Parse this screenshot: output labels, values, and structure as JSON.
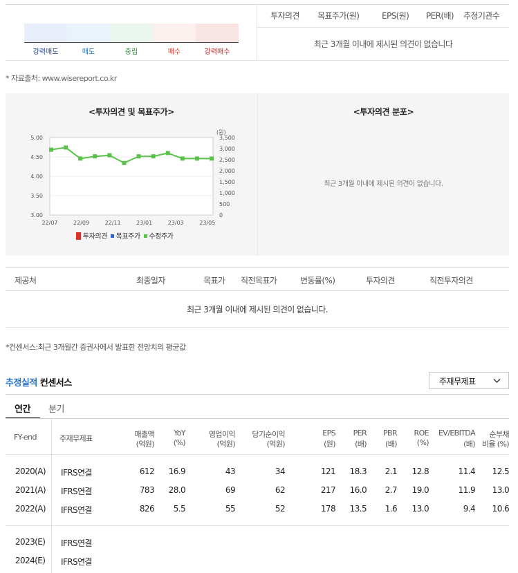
{
  "opinion_scale": {
    "labels": [
      "강력매도",
      "매도",
      "중립",
      "매수",
      "강력매수"
    ],
    "colors": [
      "#e8eefa",
      "#eaf3fc",
      "#eaf6ee",
      "#fcf0ef",
      "#fae5e5"
    ],
    "label_colors": [
      "#1a3d8f",
      "#2f6fc2",
      "#2e8b3a",
      "#e0433a",
      "#c81d1d"
    ]
  },
  "opinion_table": {
    "headers": [
      "투자의견",
      "목표주가(원)",
      "EPS(원)",
      "PER(배)",
      "추정기관수"
    ],
    "empty_message": "최근 3개월 이내에 제시된 의견이 없습니다"
  },
  "source_note": "* 자료출처: www.wisereport.co.kr",
  "chart_left": {
    "title": "<투자의견 및 목표주가>",
    "right_unit": "(원)",
    "legend": [
      "투자의견",
      "목표주가",
      "수정주가"
    ],
    "chart_data": {
      "type": "line",
      "x_ticks": [
        "22/07",
        "22/09",
        "22/11",
        "23/01",
        "23/03",
        "23/05"
      ],
      "left_axis": {
        "ticks": [
          "5.00",
          "4.50",
          "4.00",
          "3.50",
          "3.00"
        ],
        "ylim": [
          3.0,
          5.0
        ]
      },
      "right_axis": {
        "ticks": [
          "3,500",
          "3,000",
          "2,500",
          "2,000",
          "1,500",
          "1,000",
          "500",
          "0"
        ],
        "ylim": [
          0,
          3500
        ]
      },
      "series": [
        {
          "name": "수정주가",
          "color": "#5ac24a",
          "values": [
            2950,
            3050,
            2550,
            2650,
            2700,
            2350,
            2650,
            2650,
            2800,
            2550,
            2550,
            2550
          ]
        }
      ]
    }
  },
  "chart_right": {
    "title": "<투자의견 분포>",
    "empty_message": "최근 3개월 이내에 제시된 의견이 없습니다."
  },
  "broker_table": {
    "headers": [
      "제공처",
      "최종일자",
      "목표가",
      "직전목표가",
      "변동률(%)",
      "투자의견",
      "직전투자의견"
    ],
    "empty_message": "최근 3개월 이내에 제시된 의견이 없습니다."
  },
  "consensus_note": "*컨센서스:최근 3개월간 증권사에서 발표한 전망치의 평균값",
  "estimates": {
    "title_accent": "추정실적",
    "title_rest": "컨센서스",
    "dropdown_value": "주재무제표",
    "tabs": [
      "연간",
      "분기"
    ],
    "headers": [
      [
        "FY-end",
        ""
      ],
      [
        "주재무제표",
        ""
      ],
      [
        "매출액",
        "(억원)"
      ],
      [
        "YoY",
        "(%)"
      ],
      [
        "영업이익",
        "(억원)"
      ],
      [
        "당기순이익",
        "(억원)"
      ],
      [
        "EPS",
        "(원)"
      ],
      [
        "PER",
        "(배)"
      ],
      [
        "PBR",
        "(배)"
      ],
      [
        "ROE",
        "(%)"
      ],
      [
        "EV/EBITDA",
        "(배)"
      ],
      [
        "순부채",
        "비율 (%)"
      ]
    ],
    "rows": [
      [
        "2020(A)",
        "IFRS연결",
        "612",
        "16.9",
        "43",
        "34",
        "121",
        "18.3",
        "2.1",
        "12.8",
        "11.4",
        "12.5"
      ],
      [
        "2021(A)",
        "IFRS연결",
        "783",
        "28.0",
        "69",
        "62",
        "217",
        "16.0",
        "2.7",
        "19.0",
        "11.9",
        "13.0"
      ],
      [
        "2022(A)",
        "IFRS연결",
        "826",
        "5.5",
        "55",
        "52",
        "178",
        "13.5",
        "1.6",
        "13.0",
        "9.4",
        "10.6"
      ]
    ],
    "estimate_rows": [
      [
        "2023(E)",
        "IFRS연결"
      ],
      [
        "2024(E)",
        "IFRS연결"
      ]
    ]
  }
}
